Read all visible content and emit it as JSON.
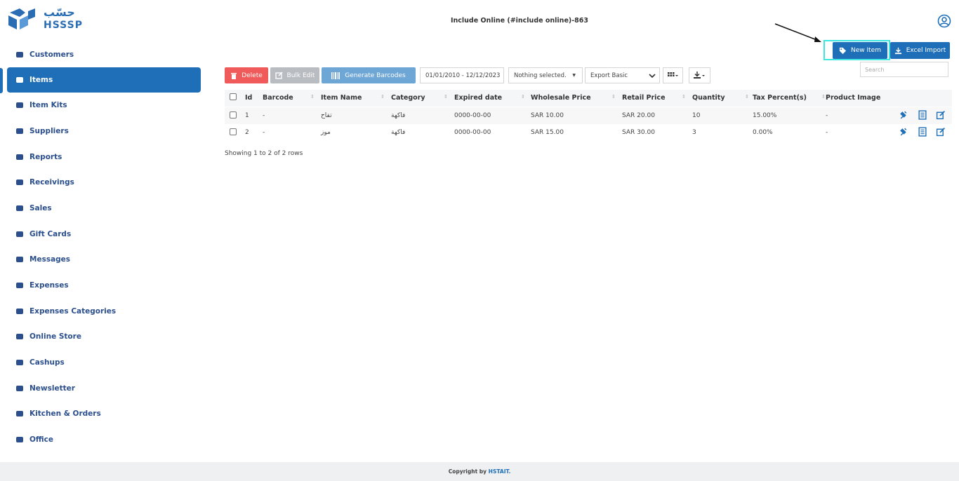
{
  "header": {
    "title": "Include Online (#include online)-863",
    "logo_ar": "حسّب",
    "logo_en": "HSSSP"
  },
  "sidebar": {
    "items": [
      {
        "label": "Customers",
        "icon": "users-icon"
      },
      {
        "label": "Items",
        "icon": "items-icon",
        "active": true
      },
      {
        "label": "Item Kits",
        "icon": "item-kits-icon"
      },
      {
        "label": "Suppliers",
        "icon": "suppliers-icon"
      },
      {
        "label": "Reports",
        "icon": "reports-icon"
      },
      {
        "label": "Receivings",
        "icon": "receivings-icon"
      },
      {
        "label": "Sales",
        "icon": "sales-icon"
      },
      {
        "label": "Gift Cards",
        "icon": "gift-icon"
      },
      {
        "label": "Messages",
        "icon": "messages-icon"
      },
      {
        "label": "Expenses",
        "icon": "expenses-icon"
      },
      {
        "label": "Expenses Categories",
        "icon": "expense-categories-icon"
      },
      {
        "label": "Online Store",
        "icon": "store-icon"
      },
      {
        "label": "Cashups",
        "icon": "cashups-icon"
      },
      {
        "label": "Newsletter",
        "icon": "newsletter-icon"
      },
      {
        "label": "Kitchen & Orders",
        "icon": "kitchen-icon"
      },
      {
        "label": "Office",
        "icon": "office-icon"
      }
    ]
  },
  "actions": {
    "new_item": "New Item",
    "excel_import": "Excel Import",
    "search_placeholder": "Search"
  },
  "toolbar": {
    "delete": "Delete",
    "bulk_edit": "Bulk Edit",
    "generate_barcodes": "Generate Barcodes",
    "date_range": "01/01/2010 - 12/12/2023",
    "filter": "Nothing selected.",
    "export": "Export Basic"
  },
  "table": {
    "columns": [
      "Id",
      "Barcode",
      "Item Name",
      "Category",
      "Expired date",
      "Wholesale Price",
      "Retail Price",
      "Quantity",
      "Tax Percent(s)",
      "Product Image"
    ],
    "rows": [
      {
        "id": "1",
        "barcode": "-",
        "name": "تفاح",
        "category": "فاكهة",
        "expired": "0000-00-00",
        "wholesale": "SAR  10.00",
        "retail": "SAR  20.00",
        "quantity": "10",
        "tax": "15.00%",
        "image": "-"
      },
      {
        "id": "2",
        "barcode": "-",
        "name": "موز",
        "category": "فاكهة",
        "expired": "0000-00-00",
        "wholesale": "SAR  15.00",
        "retail": "SAR  30.00",
        "quantity": "3",
        "tax": "0.00%",
        "image": "-"
      }
    ],
    "showing": "Showing 1 to 2 of 2 rows"
  },
  "footer": {
    "text": "Copyright by",
    "brand": "HSTAIT."
  },
  "colors": {
    "primary": "#1f6fb8",
    "danger": "#f05a5a",
    "highlight": "#3ee6e0"
  }
}
